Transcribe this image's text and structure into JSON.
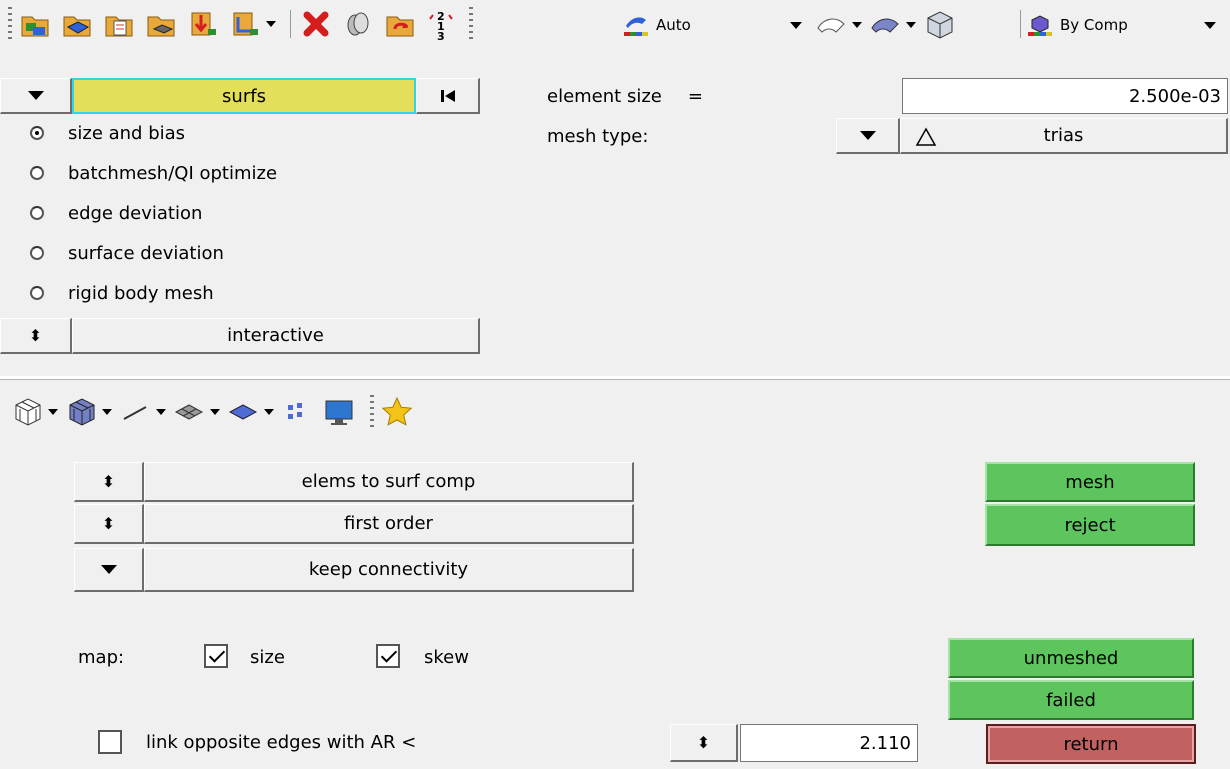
{
  "top_toolbar": {
    "icons": [
      "new-file-icon",
      "open-model-icon",
      "import-icon",
      "geometry-import-icon",
      "export-icon",
      "export-solver-icon"
    ],
    "delete_icons": [
      "delete-icon",
      "undo-icon",
      "redo-icon",
      "renumber-icon"
    ],
    "display_mode": "Auto",
    "color_mode": "By Comp"
  },
  "panel": {
    "entity_selector": "surfs",
    "element_size_label": "element size",
    "element_size_eq": "=",
    "element_size_value": "2.500e-03",
    "mesh_type_label": "mesh type:",
    "mesh_type_value": "trias",
    "radios": [
      {
        "label": "size and bias",
        "selected": true
      },
      {
        "label": "batchmesh/QI optimize",
        "selected": false
      },
      {
        "label": "edge deviation",
        "selected": false
      },
      {
        "label": "surface deviation",
        "selected": false
      },
      {
        "label": "rigid body mesh",
        "selected": false
      }
    ],
    "mode_selector": "interactive"
  },
  "lower": {
    "options": [
      "elems to surf comp",
      "first order",
      "keep connectivity"
    ],
    "map_label": "map:",
    "map_size_label": "size",
    "map_skew_label": "skew",
    "link_label": "link opposite edges with AR <",
    "ar_value": "2.110",
    "buttons": {
      "mesh": "mesh",
      "reject": "reject",
      "unmeshed": "unmeshed",
      "failed": "failed",
      "return": "return"
    }
  },
  "colors": {
    "green_button": "#5ec45e",
    "red_button": "#c26161",
    "highlight_selector": "#e3df5b"
  }
}
